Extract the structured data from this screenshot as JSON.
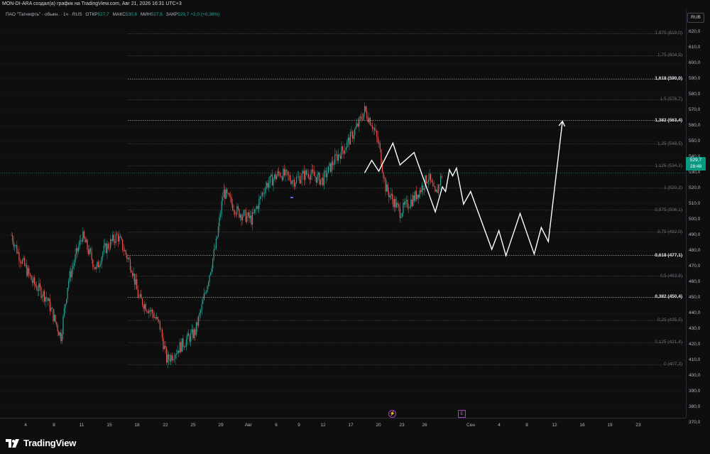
{
  "title": "MON-DI-ARA создал(а) график на TradingView.com, Авг 21, 2026 16:31 UTC+3",
  "legend": {
    "symbol": "ПАО \"Татнефть\" - обыкн. · 1ч · RUS",
    "open_label": "ОТКР",
    "open": "527,7",
    "high_label": "МАКС",
    "high": "530,8",
    "low_label": "МИН",
    "low": "527,6",
    "close_label": "ЗАКР",
    "close": "529,7",
    "change": "+2,0 (+0,38%)"
  },
  "currency": "RUB",
  "last_price": {
    "price": "529,7",
    "countdown": "28:48"
  },
  "price_axis": [
    "620,0",
    "610,0",
    "600,0",
    "590,0",
    "580,0",
    "570,0",
    "560,0",
    "550,0",
    "540,0",
    "530,0",
    "520,0",
    "510,0",
    "500,0",
    "490,0",
    "480,0",
    "470,0",
    "460,0",
    "450,0",
    "440,0",
    "430,0",
    "420,0",
    "410,0",
    "400,0",
    "390,0",
    "380,0",
    "370,0"
  ],
  "fib_levels": [
    {
      "label": "1,875 (619,0)",
      "price": 619.0,
      "strong": false
    },
    {
      "label": "1,75 (604,9)",
      "price": 604.9,
      "strong": false
    },
    {
      "label": "1,618 (590,0)",
      "price": 590.0,
      "strong": true
    },
    {
      "label": "1,5 (576,7)",
      "price": 576.7,
      "strong": false
    },
    {
      "label": "1,382 (563,4)",
      "price": 563.4,
      "strong": true
    },
    {
      "label": "1,25 (548,5)",
      "price": 548.5,
      "strong": false
    },
    {
      "label": "1,125 (534,3)",
      "price": 534.3,
      "strong": false
    },
    {
      "label": "1 (520,2)",
      "price": 520.2,
      "strong": false
    },
    {
      "label": "0,875 (506,1)",
      "price": 506.1,
      "strong": false
    },
    {
      "label": "0,75 (492,0)",
      "price": 492.0,
      "strong": false
    },
    {
      "label": "0,618 (477,1)",
      "price": 477.1,
      "strong": true
    },
    {
      "label": "0,5 (463,8)",
      "price": 463.8,
      "strong": false
    },
    {
      "label": "0,382 (450,4)",
      "price": 450.4,
      "strong": true
    },
    {
      "label": "0,25 (435,5)",
      "price": 435.5,
      "strong": false
    },
    {
      "label": "0,125 (421,4)",
      "price": 421.4,
      "strong": false
    },
    {
      "label": "0 (407,3)",
      "price": 407.3,
      "strong": false
    }
  ],
  "time_axis": [
    "4",
    "8",
    "11",
    "15",
    "18",
    "22",
    "25",
    "29",
    "Авг",
    "6",
    "9",
    "12",
    "17",
    "20",
    "23",
    "26",
    "Сен",
    "4",
    "8",
    "12",
    "16",
    "19",
    "23"
  ],
  "events": {
    "dividend_icon": "lightning-icon",
    "earnings_label": "E"
  },
  "forecast_path": [
    {
      "date": "2026-08-21",
      "price": 530
    },
    {
      "date": "2026-08-22",
      "price": 538
    },
    {
      "date": "2026-08-23",
      "price": 531
    },
    {
      "date": "2026-08-25",
      "price": 549
    },
    {
      "date": "2026-08-26",
      "price": 535
    },
    {
      "date": "2026-08-28",
      "price": 543
    },
    {
      "date": "2026-08-31",
      "price": 505
    },
    {
      "date": "2026-09-01",
      "price": 521
    },
    {
      "date": "2026-09-01",
      "price": 518
    },
    {
      "date": "2026-09-02",
      "price": 532
    },
    {
      "date": "2026-09-02",
      "price": 528
    },
    {
      "date": "2026-09-03",
      "price": 533
    },
    {
      "date": "2026-09-04",
      "price": 510
    },
    {
      "date": "2026-09-05",
      "price": 518
    },
    {
      "date": "2026-09-08",
      "price": 481
    },
    {
      "date": "2026-09-09",
      "price": 493
    },
    {
      "date": "2026-09-10",
      "price": 477
    },
    {
      "date": "2026-09-12",
      "price": 504
    },
    {
      "date": "2026-09-14",
      "price": 478
    },
    {
      "date": "2026-09-15",
      "price": 495
    },
    {
      "date": "2026-09-16",
      "price": 486
    },
    {
      "date": "2026-09-18",
      "price": 563
    }
  ],
  "colors": {
    "up": "#26a69a",
    "down": "#ef5350",
    "last_price_bg": "#089981",
    "forecast": "#ffffff"
  },
  "brand": "TradingView",
  "price_series": {
    "start": "2026-07-02",
    "anchors": [
      [
        "2026-07-02",
        490
      ],
      [
        "2026-07-03",
        478
      ],
      [
        "2026-07-05",
        460
      ],
      [
        "2026-07-07",
        450
      ],
      [
        "2026-07-09",
        425
      ],
      [
        "2026-07-10",
        460
      ],
      [
        "2026-07-12",
        490
      ],
      [
        "2026-07-14",
        468
      ],
      [
        "2026-07-15",
        480
      ],
      [
        "2026-07-17",
        490
      ],
      [
        "2026-07-19",
        470
      ],
      [
        "2026-07-20",
        450
      ],
      [
        "2026-07-22",
        440
      ],
      [
        "2026-07-23",
        432
      ],
      [
        "2026-07-24",
        410
      ],
      [
        "2026-07-27",
        424
      ],
      [
        "2026-07-28",
        428
      ],
      [
        "2026-07-29",
        445
      ],
      [
        "2026-07-31",
        485
      ],
      [
        "2026-08-01",
        518
      ],
      [
        "2026-08-03",
        505
      ],
      [
        "2026-08-05",
        500
      ],
      [
        "2026-08-07",
        522
      ],
      [
        "2026-08-09",
        530
      ],
      [
        "2026-08-11",
        525
      ],
      [
        "2026-08-13",
        530
      ],
      [
        "2026-08-15",
        525
      ],
      [
        "2026-08-17",
        540
      ],
      [
        "2026-08-18",
        545
      ],
      [
        "2026-08-20",
        560
      ],
      [
        "2026-08-21",
        570
      ],
      [
        "2026-08-22",
        562
      ],
      [
        "2026-08-23",
        548
      ],
      [
        "2026-08-24",
        520
      ],
      [
        "2026-08-26",
        505
      ],
      [
        "2026-08-28",
        514
      ],
      [
        "2026-08-29",
        520
      ],
      [
        "2026-08-30",
        528
      ],
      [
        "2026-08-31",
        515
      ],
      [
        "2026-09-01",
        530
      ]
    ]
  }
}
